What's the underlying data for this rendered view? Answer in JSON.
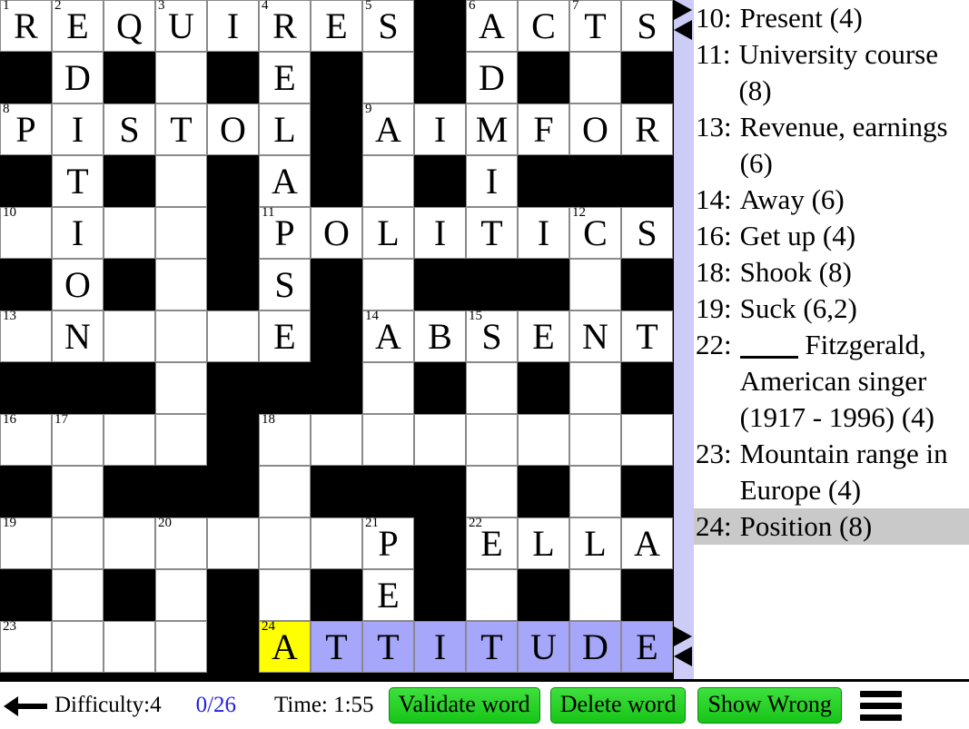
{
  "grid": {
    "columns": 13,
    "rows": 13,
    "cell_size": 57,
    "colors": {
      "block": "#000000",
      "open": "#ffffff",
      "selected_word": "#a6a6fa",
      "cursor_cell": "#ffff00",
      "grid_line": "#8a8a8a"
    },
    "cells": [
      [
        {
          "t": "open",
          "n": "1",
          "l": "R"
        },
        {
          "t": "open",
          "n": "2",
          "l": "E"
        },
        {
          "t": "open",
          "l": "Q"
        },
        {
          "t": "open",
          "n": "3",
          "l": "U"
        },
        {
          "t": "open",
          "l": "I"
        },
        {
          "t": "open",
          "n": "4",
          "l": "R"
        },
        {
          "t": "open",
          "l": "E"
        },
        {
          "t": "open",
          "n": "5",
          "l": "S"
        },
        {
          "t": "block"
        },
        {
          "t": "open",
          "n": "6",
          "l": "A"
        },
        {
          "t": "open",
          "l": "C"
        },
        {
          "t": "open",
          "n": "7",
          "l": "T"
        },
        {
          "t": "open",
          "l": "S"
        }
      ],
      [
        {
          "t": "block"
        },
        {
          "t": "open",
          "l": "D"
        },
        {
          "t": "block"
        },
        {
          "t": "open",
          "l": ""
        },
        {
          "t": "block"
        },
        {
          "t": "open",
          "l": "E"
        },
        {
          "t": "block"
        },
        {
          "t": "open",
          "l": ""
        },
        {
          "t": "block"
        },
        {
          "t": "open",
          "l": "D"
        },
        {
          "t": "block"
        },
        {
          "t": "open",
          "l": ""
        },
        {
          "t": "block"
        }
      ],
      [
        {
          "t": "open",
          "n": "8",
          "l": "P"
        },
        {
          "t": "open",
          "l": "I"
        },
        {
          "t": "open",
          "l": "S"
        },
        {
          "t": "open",
          "l": "T"
        },
        {
          "t": "open",
          "l": "O"
        },
        {
          "t": "open",
          "l": "L"
        },
        {
          "t": "block"
        },
        {
          "t": "open",
          "n": "9",
          "l": "A"
        },
        {
          "t": "open",
          "l": "I"
        },
        {
          "t": "open",
          "l": "M"
        },
        {
          "t": "open",
          "l": "F"
        },
        {
          "t": "open",
          "l": "O"
        },
        {
          "t": "open",
          "l": "R"
        }
      ],
      [
        {
          "t": "block"
        },
        {
          "t": "open",
          "l": "T"
        },
        {
          "t": "block"
        },
        {
          "t": "open",
          "l": ""
        },
        {
          "t": "block"
        },
        {
          "t": "open",
          "l": "A"
        },
        {
          "t": "block"
        },
        {
          "t": "open",
          "l": ""
        },
        {
          "t": "block"
        },
        {
          "t": "open",
          "l": "I"
        },
        {
          "t": "block"
        },
        {
          "t": "block"
        },
        {
          "t": "block"
        }
      ],
      [
        {
          "t": "open",
          "n": "10",
          "l": ""
        },
        {
          "t": "open",
          "l": "I"
        },
        {
          "t": "open",
          "l": ""
        },
        {
          "t": "open",
          "l": ""
        },
        {
          "t": "block"
        },
        {
          "t": "open",
          "n": "11",
          "l": "P"
        },
        {
          "t": "open",
          "l": "O"
        },
        {
          "t": "open",
          "l": "L"
        },
        {
          "t": "open",
          "l": "I"
        },
        {
          "t": "open",
          "l": "T"
        },
        {
          "t": "open",
          "l": "I"
        },
        {
          "t": "open",
          "n": "12",
          "l": "C"
        },
        {
          "t": "open",
          "l": "S"
        }
      ],
      [
        {
          "t": "block"
        },
        {
          "t": "open",
          "l": "O"
        },
        {
          "t": "block"
        },
        {
          "t": "open",
          "l": ""
        },
        {
          "t": "block"
        },
        {
          "t": "open",
          "l": "S"
        },
        {
          "t": "block"
        },
        {
          "t": "open",
          "l": ""
        },
        {
          "t": "block"
        },
        {
          "t": "block"
        },
        {
          "t": "block"
        },
        {
          "t": "open",
          "l": ""
        },
        {
          "t": "block"
        }
      ],
      [
        {
          "t": "open",
          "n": "13",
          "l": ""
        },
        {
          "t": "open",
          "l": "N"
        },
        {
          "t": "open",
          "l": ""
        },
        {
          "t": "open",
          "l": ""
        },
        {
          "t": "open",
          "l": ""
        },
        {
          "t": "open",
          "l": "E"
        },
        {
          "t": "block"
        },
        {
          "t": "open",
          "n": "14",
          "l": "A"
        },
        {
          "t": "open",
          "l": "B"
        },
        {
          "t": "open",
          "n": "15",
          "l": "S"
        },
        {
          "t": "open",
          "l": "E"
        },
        {
          "t": "open",
          "l": "N"
        },
        {
          "t": "open",
          "l": "T"
        }
      ],
      [
        {
          "t": "block"
        },
        {
          "t": "block"
        },
        {
          "t": "block"
        },
        {
          "t": "open",
          "l": ""
        },
        {
          "t": "block"
        },
        {
          "t": "block"
        },
        {
          "t": "block"
        },
        {
          "t": "open",
          "l": ""
        },
        {
          "t": "block"
        },
        {
          "t": "open",
          "l": ""
        },
        {
          "t": "block"
        },
        {
          "t": "open",
          "l": ""
        },
        {
          "t": "block"
        }
      ],
      [
        {
          "t": "open",
          "n": "16",
          "l": ""
        },
        {
          "t": "open",
          "n": "17",
          "l": ""
        },
        {
          "t": "open",
          "l": ""
        },
        {
          "t": "open",
          "l": ""
        },
        {
          "t": "block"
        },
        {
          "t": "open",
          "n": "18",
          "l": ""
        },
        {
          "t": "open",
          "l": ""
        },
        {
          "t": "open",
          "l": ""
        },
        {
          "t": "open",
          "l": ""
        },
        {
          "t": "open",
          "l": ""
        },
        {
          "t": "open",
          "l": ""
        },
        {
          "t": "open",
          "l": ""
        },
        {
          "t": "open",
          "l": ""
        }
      ],
      [
        {
          "t": "block"
        },
        {
          "t": "open",
          "l": ""
        },
        {
          "t": "block"
        },
        {
          "t": "block"
        },
        {
          "t": "block"
        },
        {
          "t": "open",
          "l": ""
        },
        {
          "t": "block"
        },
        {
          "t": "block"
        },
        {
          "t": "block"
        },
        {
          "t": "open",
          "l": ""
        },
        {
          "t": "block"
        },
        {
          "t": "open",
          "l": ""
        },
        {
          "t": "block"
        }
      ],
      [
        {
          "t": "open",
          "n": "19",
          "l": ""
        },
        {
          "t": "open",
          "l": ""
        },
        {
          "t": "open",
          "l": ""
        },
        {
          "t": "open",
          "n": "20",
          "l": ""
        },
        {
          "t": "open",
          "l": ""
        },
        {
          "t": "open",
          "l": ""
        },
        {
          "t": "open",
          "l": ""
        },
        {
          "t": "open",
          "n": "21",
          "l": "P"
        },
        {
          "t": "block"
        },
        {
          "t": "open",
          "n": "22",
          "l": "E"
        },
        {
          "t": "open",
          "l": "L"
        },
        {
          "t": "open",
          "l": "L"
        },
        {
          "t": "open",
          "l": "A"
        }
      ],
      [
        {
          "t": "block"
        },
        {
          "t": "open",
          "l": ""
        },
        {
          "t": "block"
        },
        {
          "t": "open",
          "l": ""
        },
        {
          "t": "block"
        },
        {
          "t": "open",
          "l": ""
        },
        {
          "t": "block"
        },
        {
          "t": "open",
          "l": "E"
        },
        {
          "t": "block"
        },
        {
          "t": "open",
          "l": ""
        },
        {
          "t": "block"
        },
        {
          "t": "open",
          "l": ""
        },
        {
          "t": "block"
        }
      ],
      [
        {
          "t": "open",
          "n": "23",
          "l": ""
        },
        {
          "t": "open",
          "l": ""
        },
        {
          "t": "open",
          "l": ""
        },
        {
          "t": "open",
          "l": ""
        },
        {
          "t": "block"
        },
        {
          "t": "cursor",
          "n": "24",
          "l": "A"
        },
        {
          "t": "sel",
          "l": "T"
        },
        {
          "t": "sel",
          "l": "T"
        },
        {
          "t": "sel",
          "l": "I"
        },
        {
          "t": "sel",
          "l": "T"
        },
        {
          "t": "sel",
          "l": "U"
        },
        {
          "t": "sel",
          "l": "D"
        },
        {
          "t": "sel",
          "l": "E"
        }
      ]
    ]
  },
  "clues": {
    "items": [
      {
        "num": "",
        "text": "",
        "active": false,
        "partial": true
      },
      {
        "num": "10:",
        "text": "Present (4)",
        "active": false
      },
      {
        "num": "11:",
        "text": "University course (8)",
        "active": false
      },
      {
        "num": "13:",
        "text": "Revenue, earnings (6)",
        "active": false
      },
      {
        "num": "14:",
        "text": "Away (6)",
        "active": false
      },
      {
        "num": "16:",
        "text": "Get up (4)",
        "active": false
      },
      {
        "num": "18:",
        "text": "Shook (8)",
        "active": false
      },
      {
        "num": "19:",
        "text": "Suck (6,2)",
        "active": false
      },
      {
        "num": "22:",
        "text": "Fitzgerald, American singer (1917 - 1996) (4)",
        "active": false,
        "leading_blank": true
      },
      {
        "num": "23:",
        "text": "Mountain range in Europe (4)",
        "active": false
      },
      {
        "num": "24:",
        "text": "Position (8)",
        "active": true
      }
    ],
    "active_highlight_color": "#c9c9c9"
  },
  "scrollstrip": {
    "color": "#ccccf7",
    "markers": [
      0,
      690
    ]
  },
  "toolbar": {
    "back_label": "back-arrow",
    "difficulty": "Difficulty:4",
    "progress": "0/26",
    "time": "Time: 1:55",
    "validate_label": "Validate word",
    "delete_label": "Delete word",
    "show_wrong_label": "Show Wrong",
    "menu_label": "hamburger-menu",
    "button_color": "#22cc22",
    "progress_color": "#2222dd"
  }
}
